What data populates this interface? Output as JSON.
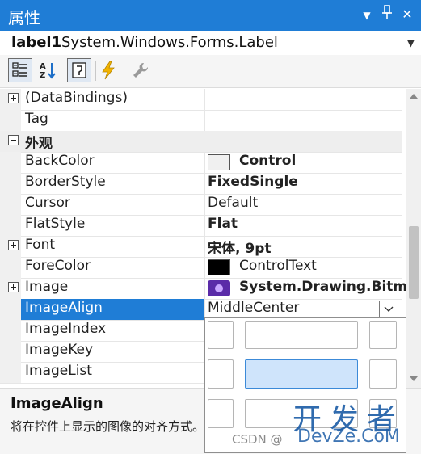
{
  "window": {
    "title": "属性",
    "dropdown_glyph": "▼",
    "pin_glyph": "⊥",
    "close_glyph": "✕"
  },
  "object_selector": {
    "name": "label1",
    "type": "System.Windows.Forms.Label"
  },
  "toolbar": {
    "buttons": [
      "categorized",
      "alphabetical",
      "properties",
      "events",
      "property-pages"
    ],
    "active": [
      "categorized",
      "properties"
    ]
  },
  "properties": {
    "rows": [
      {
        "name": "(DataBindings)",
        "value": "",
        "expander": "plus"
      },
      {
        "name": "Tag",
        "value": ""
      },
      {
        "name": "外观",
        "category": true,
        "expander": "minus"
      },
      {
        "name": "BackColor",
        "value": "Control",
        "swatch": "#f0f0f0",
        "bold": true
      },
      {
        "name": "BorderStyle",
        "value": "FixedSingle",
        "bold": true
      },
      {
        "name": "Cursor",
        "value": "Default"
      },
      {
        "name": "FlatStyle",
        "value": "Flat",
        "bold": true
      },
      {
        "name": "Font",
        "value": "宋体, 9pt",
        "bold": true,
        "expander": "plus"
      },
      {
        "name": "ForeColor",
        "value": "ControlText",
        "swatch": "#000000"
      },
      {
        "name": "Image",
        "value": "System.Drawing.Bitma",
        "bold": true,
        "expander": "plus",
        "image": true
      },
      {
        "name": "ImageAlign",
        "value": "MiddleCenter",
        "selected": true
      },
      {
        "name": "ImageIndex",
        "value": ""
      },
      {
        "name": "ImageKey",
        "value": ""
      },
      {
        "name": "ImageList",
        "value": ""
      }
    ]
  },
  "align_picker": {
    "options": [
      "TopLeft",
      "TopCenter",
      "TopRight",
      "MiddleLeft",
      "MiddleCenter",
      "MiddleRight",
      "BottomLeft",
      "BottomCenter",
      "BottomRight"
    ],
    "selected": "MiddleCenter"
  },
  "description": {
    "title": "ImageAlign",
    "text": "将在控件上显示的图像的对齐方式。"
  },
  "watermark": {
    "line1": "开发者",
    "line2": "DevZe.CoM",
    "csdn": "CSDN @"
  },
  "colors": {
    "accent": "#1f7dd6",
    "selected_cell": "#cfe4fb"
  }
}
